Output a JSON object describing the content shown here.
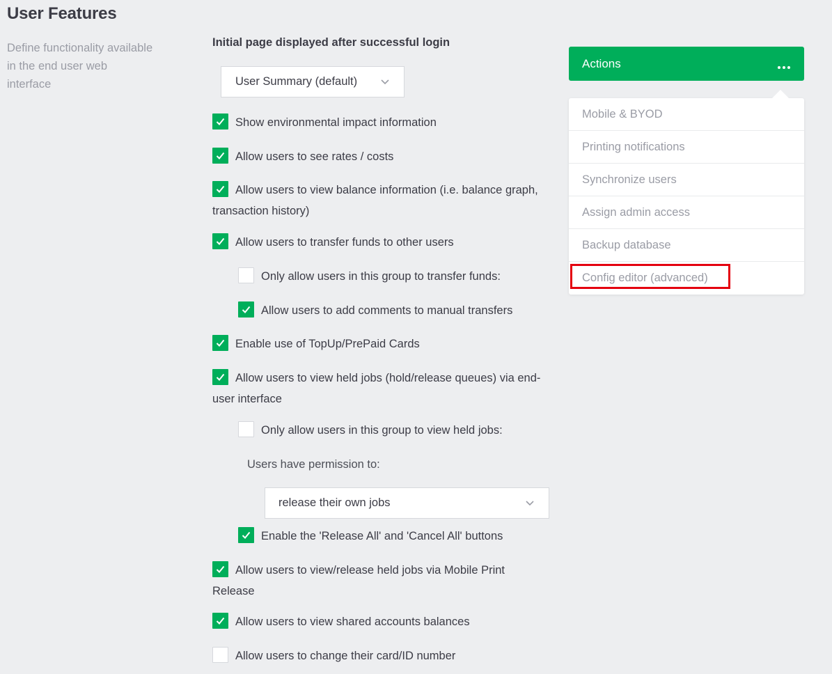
{
  "section": {
    "title": "User Features",
    "description": "Define functionality available in the end user web interface"
  },
  "initial_page": {
    "label": "Initial page displayed after successful login",
    "selected": "User Summary (default)"
  },
  "options": [
    {
      "label": "Show environmental impact information",
      "checked": true
    },
    {
      "label": "Allow users to see rates / costs",
      "checked": true
    },
    {
      "label": "Allow users to view balance information (i.e. balance graph, transaction history)",
      "checked": true
    },
    {
      "label": "Allow users to transfer funds to other users",
      "checked": true
    },
    {
      "label": "Only allow users in this group to transfer funds:",
      "checked": false
    },
    {
      "label": "Allow users to add comments to manual transfers",
      "checked": true
    },
    {
      "label": "Enable use of TopUp/PrePaid Cards",
      "checked": true
    },
    {
      "label": "Allow users to view held jobs (hold/release queues) via end-user interface",
      "checked": true
    },
    {
      "label": "Only allow users in this group to view held jobs:",
      "checked": false
    },
    {
      "label": "Enable the 'Release All' and 'Cancel All' buttons",
      "checked": true
    },
    {
      "label": "Allow users to view/release held jobs via Mobile Print Release",
      "checked": true
    },
    {
      "label": "Allow users to view shared accounts balances",
      "checked": true
    },
    {
      "label": "Allow users to change their card/ID number",
      "checked": false
    }
  ],
  "permission": {
    "label": "Users have permission to:",
    "selected": "release their own jobs"
  },
  "actions": {
    "label": "Actions",
    "menu_icon": "more-horizontal-icon",
    "items": [
      {
        "label": "Mobile & BYOD"
      },
      {
        "label": "Printing notifications"
      },
      {
        "label": "Synchronize users"
      },
      {
        "label": "Assign admin access"
      },
      {
        "label": "Backup database"
      },
      {
        "label": "Config editor (advanced)",
        "highlighted": true
      }
    ]
  },
  "colors": {
    "accent": "#00ae5a",
    "highlight": "#e4000f",
    "background": "#edeef0"
  }
}
